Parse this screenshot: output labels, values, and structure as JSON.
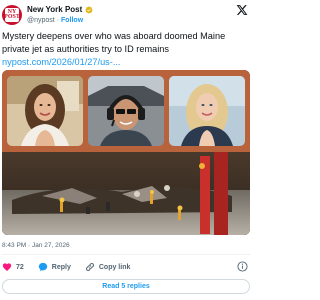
{
  "account": {
    "display_name": "New York Post",
    "handle": "@nypost",
    "separator": "·",
    "follow_label": "Follow",
    "avatar_text": "NEW YORK POST"
  },
  "tweet": {
    "text": "Mystery deepens over who was aboard doomed Maine private jet as authorities try to ID remains",
    "link": "nypost.com/2026/01/27/us-..."
  },
  "meta": {
    "timestamp": "8:43 PM · Jan 27, 2026"
  },
  "actions": {
    "like_count": "72",
    "reply_label": "Reply",
    "copy_label": "Copy link"
  },
  "replies_button": "Read 5 replies",
  "icons": {
    "verified": "verified-badge-icon",
    "x_logo": "x-logo-icon",
    "like": "heart-icon",
    "reply": "reply-bubble-icon",
    "copy": "link-icon",
    "info": "info-icon"
  },
  "colors": {
    "accent": "#1d9bf0",
    "like": "#f91880",
    "brand": "#c8102e"
  }
}
